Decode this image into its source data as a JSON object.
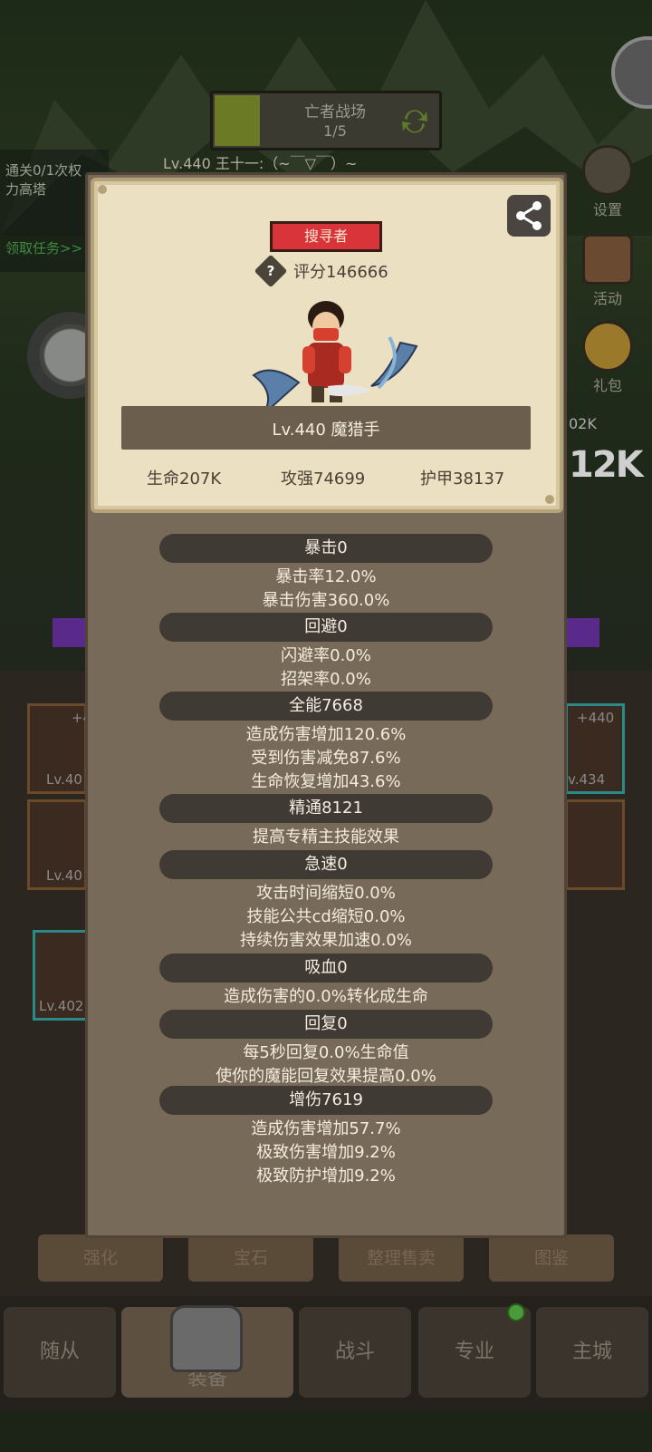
{
  "background": {
    "stage_title": "亡者战场",
    "stage_progress": "1/5",
    "player_name": "Lv.440 王十一:（~￣▽￣）~",
    "quest_lines": [
      "通关0/1次权",
      "力高塔"
    ],
    "quest_link": "领取任务>>",
    "right_menu": [
      {
        "label": "设置",
        "icon": "gear-icon"
      },
      {
        "label": "活动",
        "icon": "scroll-icon"
      },
      {
        "label": "礼包",
        "icon": "giftbag-icon"
      }
    ],
    "side_values": {
      "small": "02K",
      "big": "12K",
      "slot_plus_left": "+4",
      "slot_plus_right": "+440"
    },
    "slot_levels": [
      "Lv.40",
      "Lv.40",
      "Lv.402",
      "v.434"
    ]
  },
  "function_buttons": [
    "强化",
    "宝石",
    "整理售卖",
    "图鉴"
  ],
  "bottom_nav": [
    "随从",
    "装备",
    "战斗",
    "专业",
    "主城"
  ],
  "card": {
    "title_badge": "搜寻者",
    "score": "评分146666",
    "character_name": "Lv.440 魔猎手",
    "stats": [
      "生命207K",
      "攻强74699",
      "护甲38137"
    ]
  },
  "sections": [
    {
      "header": "暴击0",
      "lines": [
        "暴击率12.0%",
        "暴击伤害360.0%"
      ]
    },
    {
      "header": "回避0",
      "lines": [
        "闪避率0.0%",
        "招架率0.0%"
      ]
    },
    {
      "header": "全能7668",
      "lines": [
        "造成伤害增加120.6%",
        "受到伤害减免87.6%",
        "生命恢复增加43.6%"
      ]
    },
    {
      "header": "精通8121",
      "lines": [
        "提高专精主技能效果"
      ]
    },
    {
      "header": "急速0",
      "lines": [
        "攻击时间缩短0.0%",
        "技能公共cd缩短0.0%",
        "持续伤害效果加速0.0%"
      ]
    },
    {
      "header": "吸血0",
      "lines": [
        "造成伤害的0.0%转化成生命"
      ]
    },
    {
      "header": "回复0",
      "lines": [
        "每5秒回复0.0%生命值",
        "使你的魔能回复效果提高0.0%"
      ]
    },
    {
      "header": "增伤7619",
      "lines": [
        "造成伤害增加57.7%",
        "极致伤害增加9.2%",
        "极致防护增加9.2%"
      ]
    }
  ]
}
